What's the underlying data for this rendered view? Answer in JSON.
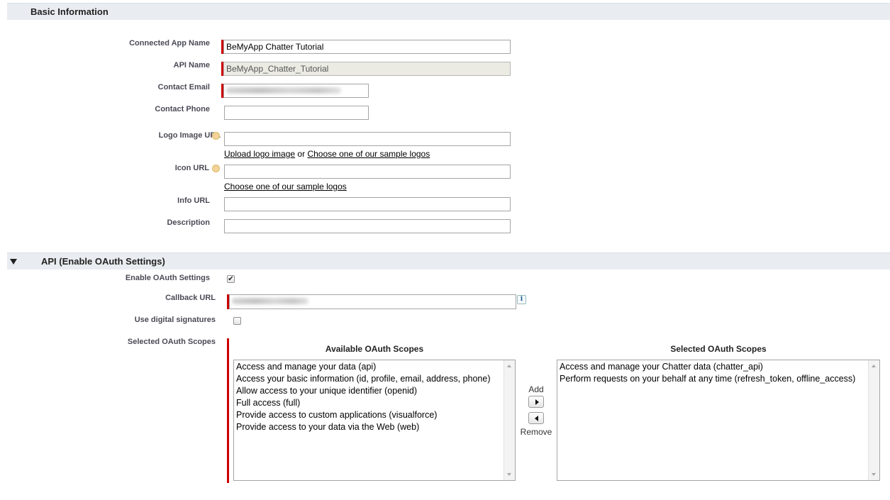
{
  "sections": {
    "basic": {
      "title": "Basic Information"
    },
    "api": {
      "title": "API (Enable OAuth Settings)"
    }
  },
  "basic_fields": {
    "connected_app_name": {
      "label": "Connected App Name",
      "value": "BeMyApp Chatter Tutorial"
    },
    "api_name": {
      "label": "API Name",
      "value": "BeMyApp_Chatter_Tutorial"
    },
    "contact_email": {
      "label": "Contact Email",
      "value": ""
    },
    "contact_phone": {
      "label": "Contact Phone",
      "value": ""
    },
    "logo_image_url": {
      "label": "Logo Image URL",
      "value": "",
      "upload_link": "Upload logo image",
      "or_text": "or",
      "sample_link": "Choose one of our sample logos"
    },
    "icon_url": {
      "label": "Icon URL",
      "value": "",
      "sample_link": "Choose one of our sample logos"
    },
    "info_url": {
      "label": "Info URL",
      "value": ""
    },
    "description": {
      "label": "Description",
      "value": ""
    }
  },
  "api_fields": {
    "enable_oauth": {
      "label": "Enable OAuth Settings",
      "checked": true
    },
    "callback_url": {
      "label": "Callback URL",
      "value": ""
    },
    "digital_signatures": {
      "label": "Use digital signatures",
      "checked": false
    },
    "oauth_scopes": {
      "label": "Selected OAuth Scopes",
      "available_title": "Available OAuth Scopes",
      "selected_title": "Selected OAuth Scopes",
      "available": [
        "Access and manage your data (api)",
        "Access your basic information (id, profile, email, address, phone)",
        "Allow access to your unique identifier (openid)",
        "Full access (full)",
        "Provide access to custom applications (visualforce)",
        "Provide access to your data via the Web (web)"
      ],
      "selected": [
        "Access and manage your Chatter data (chatter_api)",
        "Perform requests on your behalf at any time (refresh_token, offline_access)"
      ],
      "add_label": "Add",
      "remove_label": "Remove"
    }
  },
  "icons": {
    "help": "help-icon",
    "info": "info-icon",
    "checkmark": "✔"
  },
  "colors": {
    "required": "#cc0000",
    "section_bg": "#e9ecf0"
  }
}
